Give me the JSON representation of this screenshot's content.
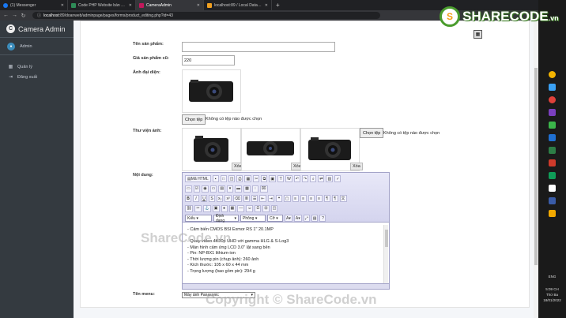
{
  "browser": {
    "tabs": [
      {
        "title": "(1) Messenger",
        "color": "#1877f2",
        "active": false
      },
      {
        "title": "Code PHP Website bán máy tính",
        "color": "#2e8b57",
        "active": false
      },
      {
        "title": "CameraAdmin",
        "color": "#c2185b",
        "active": true
      },
      {
        "title": "localhost:89 / Local Databases / ...",
        "color": "#f0a020",
        "active": false
      }
    ],
    "url_host": "localhost",
    "url_path": ":89/doanweb/adminpage/pages/forms/product_editing.php?id=43"
  },
  "sidebar": {
    "brand": "Camera Admin",
    "brand_icon": "C",
    "user": "Admin",
    "items": [
      {
        "label": "Quản lý",
        "icon": "grid-icon"
      },
      {
        "label": "Đăng xuất",
        "icon": "logout-icon"
      }
    ]
  },
  "form": {
    "name_label": "Tên sản phẩm:",
    "name_value": "",
    "oldprice_label": "Giá sản phẩm cũ:",
    "oldprice_value": "220",
    "avatar_label": "Ảnh đại diện:",
    "file_button": "Chọn tệp",
    "file_none": "Không có tệp nào được chọn",
    "gallery_label": "Thư viện ảnh:",
    "delete_label": "Xóa",
    "content_label": "Nội dung:",
    "menu_label": "Tên menu:",
    "menu_value": "Máy ảnh Panasonic"
  },
  "editor": {
    "source_label": "Mã HTML",
    "format_combo": "Kiểu",
    "style_combo": "Định dạng",
    "font_combo": "Phông",
    "size_combo": "Cỡ",
    "lines": [
      "- Cảm biến CMOS BSI Exmor RS 1\" 20.1MP",
      "",
      "- Quay video 4K30p UHD với gamma HLG & S-Log3",
      "- Màn hình cảm ứng LCD 3.0\" lật sang bên",
      "- Pin: NP-BX1 lithium-ion",
      "- Thời lượng pin (chụp ảnh): 260 ảnh",
      "- Kích thước: 105 x 60 x 44 mm",
      "- Trọng lượng (bao gồm pin): 294 g"
    ]
  },
  "taskbar": {
    "lang": "ENG",
    "time": "5:09 CH",
    "day": "Thứ Ba",
    "date": "18/01/2022"
  },
  "watermark": {
    "logo": "SHARECODE",
    "logo_suffix": ".vn",
    "center": "ShareCode.vn",
    "copyright": "Copyright © ShareCode.vn"
  }
}
